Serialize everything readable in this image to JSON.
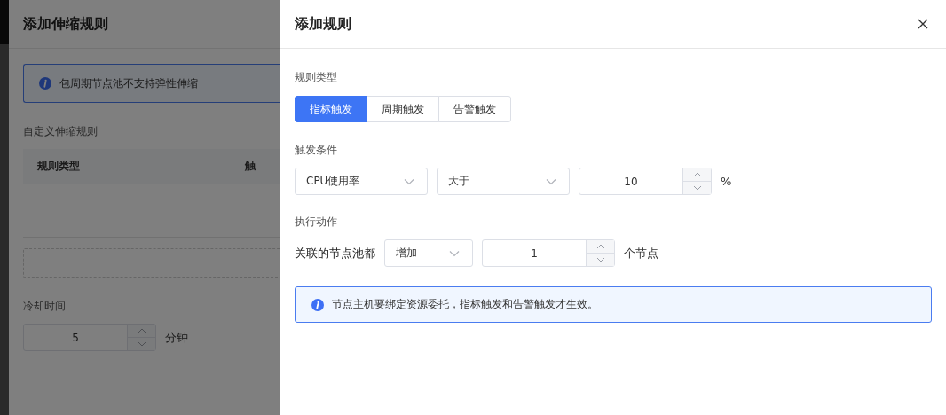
{
  "background_page": {
    "title": "添加伸缩规则",
    "alert": "包周期节点池不支持弹性伸缩",
    "section_label": "自定义伸缩规则",
    "table": {
      "columns": [
        "规则类型",
        "触"
      ]
    },
    "cooldown": {
      "label": "冷却时间",
      "value": "5",
      "unit": "分钟"
    }
  },
  "drawer": {
    "title": "添加规则",
    "rule_type": {
      "label": "规则类型",
      "options": [
        {
          "label": "指标触发",
          "selected": true
        },
        {
          "label": "周期触发",
          "selected": false
        },
        {
          "label": "告警触发",
          "selected": false
        }
      ]
    },
    "trigger_condition": {
      "label": "触发条件",
      "metric": "CPU使用率",
      "operator": "大于",
      "threshold": "10",
      "unit": "%"
    },
    "action": {
      "label": "执行动作",
      "prefix": "关联的节点池都",
      "operation": "增加",
      "count": "1",
      "unit": "个节点"
    },
    "alert": "节点主机要绑定资源委托，指标触发和告警触发才生效。"
  }
}
